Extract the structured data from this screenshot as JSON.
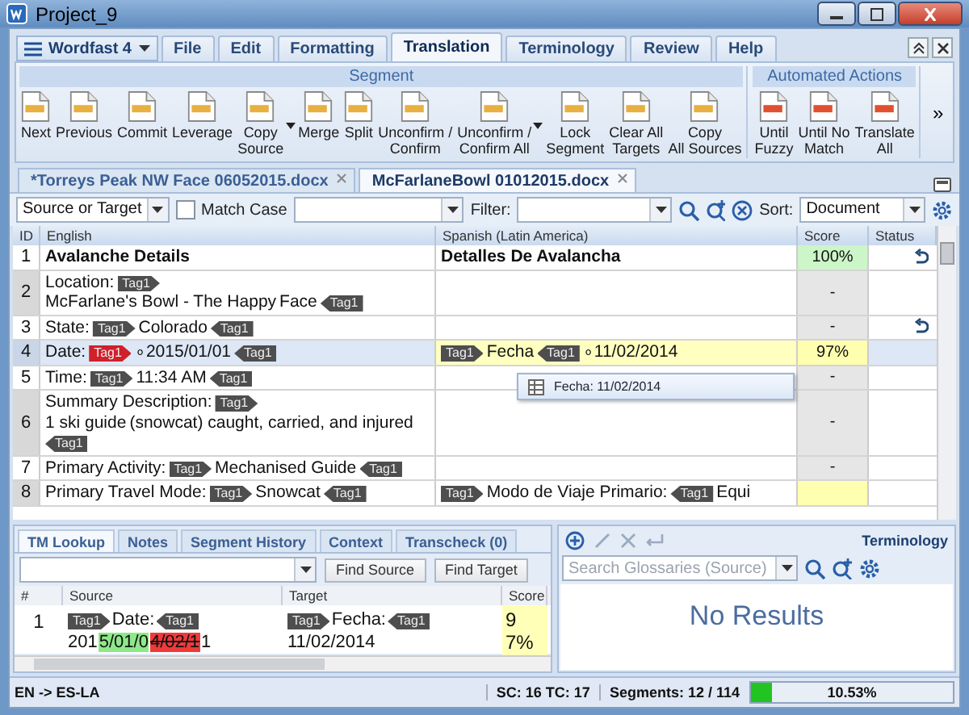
{
  "window": {
    "title": "Project_9"
  },
  "app_menu": {
    "label": "Wordfast 4"
  },
  "menu_tabs": [
    {
      "label": "File",
      "selected": false
    },
    {
      "label": "Edit",
      "selected": false
    },
    {
      "label": "Formatting",
      "selected": false
    },
    {
      "label": "Translation",
      "selected": true
    },
    {
      "label": "Terminology",
      "selected": false
    },
    {
      "label": "Review",
      "selected": false
    },
    {
      "label": "Help",
      "selected": false
    }
  ],
  "ribbon": {
    "groups": [
      {
        "title": "Segment",
        "buttons": [
          {
            "label": "Next",
            "dropdown": false
          },
          {
            "label": "Previous",
            "dropdown": false
          },
          {
            "label": "Commit",
            "dropdown": false
          },
          {
            "label": "Leverage",
            "dropdown": false
          },
          {
            "label": "Copy\nSource",
            "dropdown": true
          },
          {
            "label": "Merge",
            "dropdown": false
          },
          {
            "label": "Split",
            "dropdown": false
          },
          {
            "label": "Unconfirm /\nConfirm",
            "dropdown": false
          },
          {
            "label": "Unconfirm /\nConfirm All",
            "dropdown": true
          },
          {
            "label": "Lock\nSegment",
            "dropdown": false
          },
          {
            "label": "Clear All\nTargets",
            "dropdown": false
          },
          {
            "label": "Copy\nAll Sources",
            "dropdown": false
          }
        ]
      },
      {
        "title": "Automated Actions",
        "buttons": [
          {
            "label": "Until\nFuzzy",
            "dropdown": false
          },
          {
            "label": "Until No\nMatch",
            "dropdown": false
          },
          {
            "label": "Translate\nAll",
            "dropdown": false
          }
        ]
      }
    ],
    "more": "»"
  },
  "doc_tabs": [
    {
      "label": "*Torreys Peak NW Face 06052015.docx",
      "selected": false
    },
    {
      "label": "McFarlaneBowl 01012015.docx",
      "selected": true
    }
  ],
  "filter_bar": {
    "scope": "Source or Target",
    "match_case": {
      "label": "Match Case",
      "checked": false
    },
    "filter_label": "Filter:",
    "sort_label": "Sort:",
    "sort": "Document"
  },
  "grid": {
    "columns": [
      "ID",
      "English",
      "Spanish (Latin America)",
      "Score",
      "Status"
    ],
    "rows": [
      {
        "id": "1",
        "bold": true,
        "selected": false,
        "confirmed": true,
        "score": {
          "text": "100%",
          "color": "#ccf5c8"
        },
        "source": [
          {
            "kind": "text",
            "text": "Avalanche Details"
          }
        ],
        "target": [
          {
            "kind": "text",
            "text": "Detalles De Avalancha"
          }
        ]
      },
      {
        "id": "2",
        "bold": false,
        "selected": false,
        "confirmed": false,
        "score": {
          "text": "-",
          "color": "#e6e6e6"
        },
        "source": [
          {
            "kind": "text",
            "text": "Location:"
          },
          {
            "kind": "tag_open",
            "text": "Tag1"
          },
          {
            "kind": "text",
            "text": "McFarlane's Bowl - The Happy"
          },
          {
            "kind": "text",
            "text": "Face"
          },
          {
            "kind": "tag_close",
            "text": "Tag1"
          }
        ],
        "target": []
      },
      {
        "id": "3",
        "bold": false,
        "selected": false,
        "confirmed": true,
        "score": {
          "text": "-",
          "color": "#e6e6e6"
        },
        "source": [
          {
            "kind": "text",
            "text": "State:"
          },
          {
            "kind": "tag_open",
            "text": "Tag1"
          },
          {
            "kind": "text",
            "text": "Colorado"
          },
          {
            "kind": "tag_close",
            "text": "Tag1"
          }
        ],
        "target": []
      },
      {
        "id": "4",
        "bold": false,
        "selected": true,
        "confirmed": false,
        "score": {
          "text": "97%",
          "color": "#ffffb0"
        },
        "source": [
          {
            "kind": "text",
            "text": "Date:"
          },
          {
            "kind": "tag_open_error",
            "text": "Tag1"
          },
          {
            "kind": "text",
            "text": "∘2015/01/01"
          },
          {
            "kind": "tag_close",
            "text": "Tag1"
          }
        ],
        "target": [
          {
            "kind": "tag_open",
            "text": "Tag1"
          },
          {
            "kind": "text",
            "text": "Fecha"
          },
          {
            "kind": "tag_close",
            "text": "Tag1"
          },
          {
            "kind": "text",
            "text": "∘11/02/2014"
          }
        ]
      },
      {
        "id": "5",
        "bold": false,
        "selected": false,
        "confirmed": false,
        "score": {
          "text": "-",
          "color": "#e6e6e6"
        },
        "source": [
          {
            "kind": "text",
            "text": "Time:"
          },
          {
            "kind": "tag_open",
            "text": "Tag1"
          },
          {
            "kind": "text",
            "text": "11:34 AM"
          },
          {
            "kind": "tag_close",
            "text": "Tag1"
          }
        ],
        "target": []
      },
      {
        "id": "6",
        "bold": false,
        "selected": false,
        "confirmed": false,
        "score": {
          "text": "-",
          "color": "#e6e6e6"
        },
        "source": [
          {
            "kind": "text",
            "text": "Summary Description:"
          },
          {
            "kind": "tag_open",
            "text": "Tag1"
          },
          {
            "kind": "text",
            "text": "1 ski guide"
          },
          {
            "kind": "text",
            "text": "(snowcat) caught, carried, and injured"
          },
          {
            "kind": "tag_close",
            "text": "Tag1"
          }
        ],
        "target": []
      },
      {
        "id": "7",
        "bold": false,
        "selected": false,
        "confirmed": false,
        "score": {
          "text": "-",
          "color": "#e6e6e6"
        },
        "source": [
          {
            "kind": "text",
            "text": "Primary Activity:"
          },
          {
            "kind": "tag_open",
            "text": "Tag1"
          },
          {
            "kind": "text",
            "text": "Mechanised Guide"
          },
          {
            "kind": "tag_close",
            "text": "Tag1"
          }
        ],
        "target": []
      },
      {
        "id": "8",
        "bold": false,
        "selected": false,
        "confirmed": false,
        "score": {
          "color": "#ffffb0"
        },
        "source": [
          {
            "kind": "text",
            "text": "Primary Travel Mode:"
          },
          {
            "kind": "tag_open",
            "text": "Tag1"
          },
          {
            "kind": "text",
            "text": "Snowcat"
          },
          {
            "kind": "tag_close",
            "text": "Tag1"
          }
        ],
        "target": [
          {
            "kind": "tag_open",
            "text": "Tag1"
          },
          {
            "kind": "text",
            "text": "Modo de Viaje Primario:"
          },
          {
            "kind": "tag_close",
            "text": "Tag1"
          },
          {
            "kind": "text",
            "text": "Equi"
          }
        ]
      }
    ]
  },
  "autocomplete": {
    "text": "Fecha: 11/02/2014"
  },
  "bottom_tabs": [
    {
      "label": "TM Lookup",
      "selected": true
    },
    {
      "label": "Notes",
      "selected": false
    },
    {
      "label": "Segment History",
      "selected": false
    },
    {
      "label": "Context",
      "selected": false
    },
    {
      "label": "Transcheck (0)",
      "selected": false
    }
  ],
  "tm": {
    "find_source": "Find Source",
    "find_target": "Find Target",
    "columns": [
      "#",
      "Source",
      "Target",
      "Score"
    ],
    "rows": [
      {
        "id": "1",
        "score": "97%",
        "source": [
          {
            "kind": "tag_open",
            "text": "Tag1"
          },
          {
            "kind": "text",
            "text": "Date:"
          },
          {
            "kind": "tag_close",
            "text": "Tag1"
          },
          {
            "kind": "text",
            "text": "201"
          },
          {
            "kind": "inserted",
            "text": "5/01/0"
          },
          {
            "kind": "deleted",
            "text": "4/02/1"
          },
          {
            "kind": "text",
            "text": "1"
          }
        ],
        "target": [
          {
            "kind": "tag_open",
            "text": "Tag1"
          },
          {
            "kind": "text",
            "text": "Fecha:"
          },
          {
            "kind": "tag_close",
            "text": "Tag1"
          },
          {
            "kind": "text",
            "text": "11/02/2014"
          }
        ]
      }
    ]
  },
  "terminology": {
    "title": "Terminology",
    "search_placeholder": "Search Glossaries (Source)",
    "empty": "No Results"
  },
  "status_bar": {
    "languages": "EN -> ES-LA",
    "counts": "SC: 16 TC: 17",
    "segments": "Segments: 12 / 114",
    "progress": {
      "level": 0.1053,
      "reading": "10.53%"
    }
  }
}
